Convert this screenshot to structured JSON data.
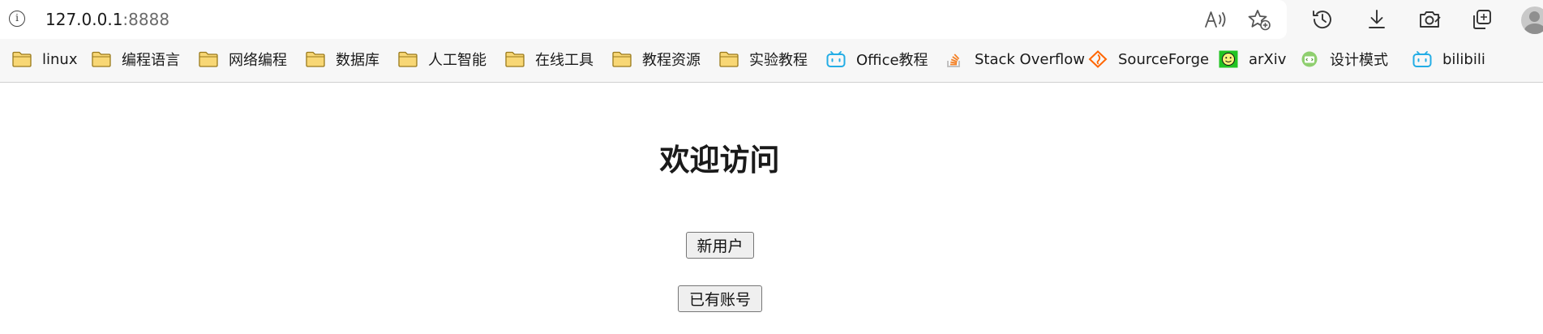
{
  "browser": {
    "url_host": "127.0.0.1",
    "url_port": ":8888",
    "icons": {
      "info": "info-icon",
      "read_aloud": "read-aloud-icon",
      "favorite": "favorite-add-icon",
      "history": "history-icon",
      "downloads": "download-icon",
      "screenshot": "screenshot-icon",
      "collections": "collections-icon",
      "profile": "profile-avatar"
    }
  },
  "bookmarks": [
    {
      "label": "linux",
      "icon": "folder-icon"
    },
    {
      "label": "编程语言",
      "icon": "folder-icon"
    },
    {
      "label": "网络编程",
      "icon": "folder-icon"
    },
    {
      "label": "数据库",
      "icon": "folder-icon"
    },
    {
      "label": "人工智能",
      "icon": "folder-icon"
    },
    {
      "label": "在线工具",
      "icon": "folder-icon"
    },
    {
      "label": "教程资源",
      "icon": "folder-icon"
    },
    {
      "label": "实验教程",
      "icon": "folder-icon"
    },
    {
      "label": "Office教程",
      "icon": "bilibili-icon"
    },
    {
      "label": "Stack Overflow",
      "icon": "stackoverflow-icon"
    },
    {
      "label": "SourceForge",
      "icon": "sourceforge-icon"
    },
    {
      "label": "arXiv",
      "icon": "arxiv-icon"
    },
    {
      "label": "设计模式",
      "icon": "design-patterns-icon"
    },
    {
      "label": "bilibili",
      "icon": "bilibili-icon"
    }
  ],
  "page": {
    "title": "欢迎访问",
    "new_user_button": "新用户",
    "existing_account_button": "已有账号"
  },
  "colors": {
    "folder": "#f5c542",
    "bilibili": "#23ade5",
    "stackoverflow": "#f48024",
    "sourceforge": "#ff6600",
    "arxiv_bg": "#22c422"
  }
}
